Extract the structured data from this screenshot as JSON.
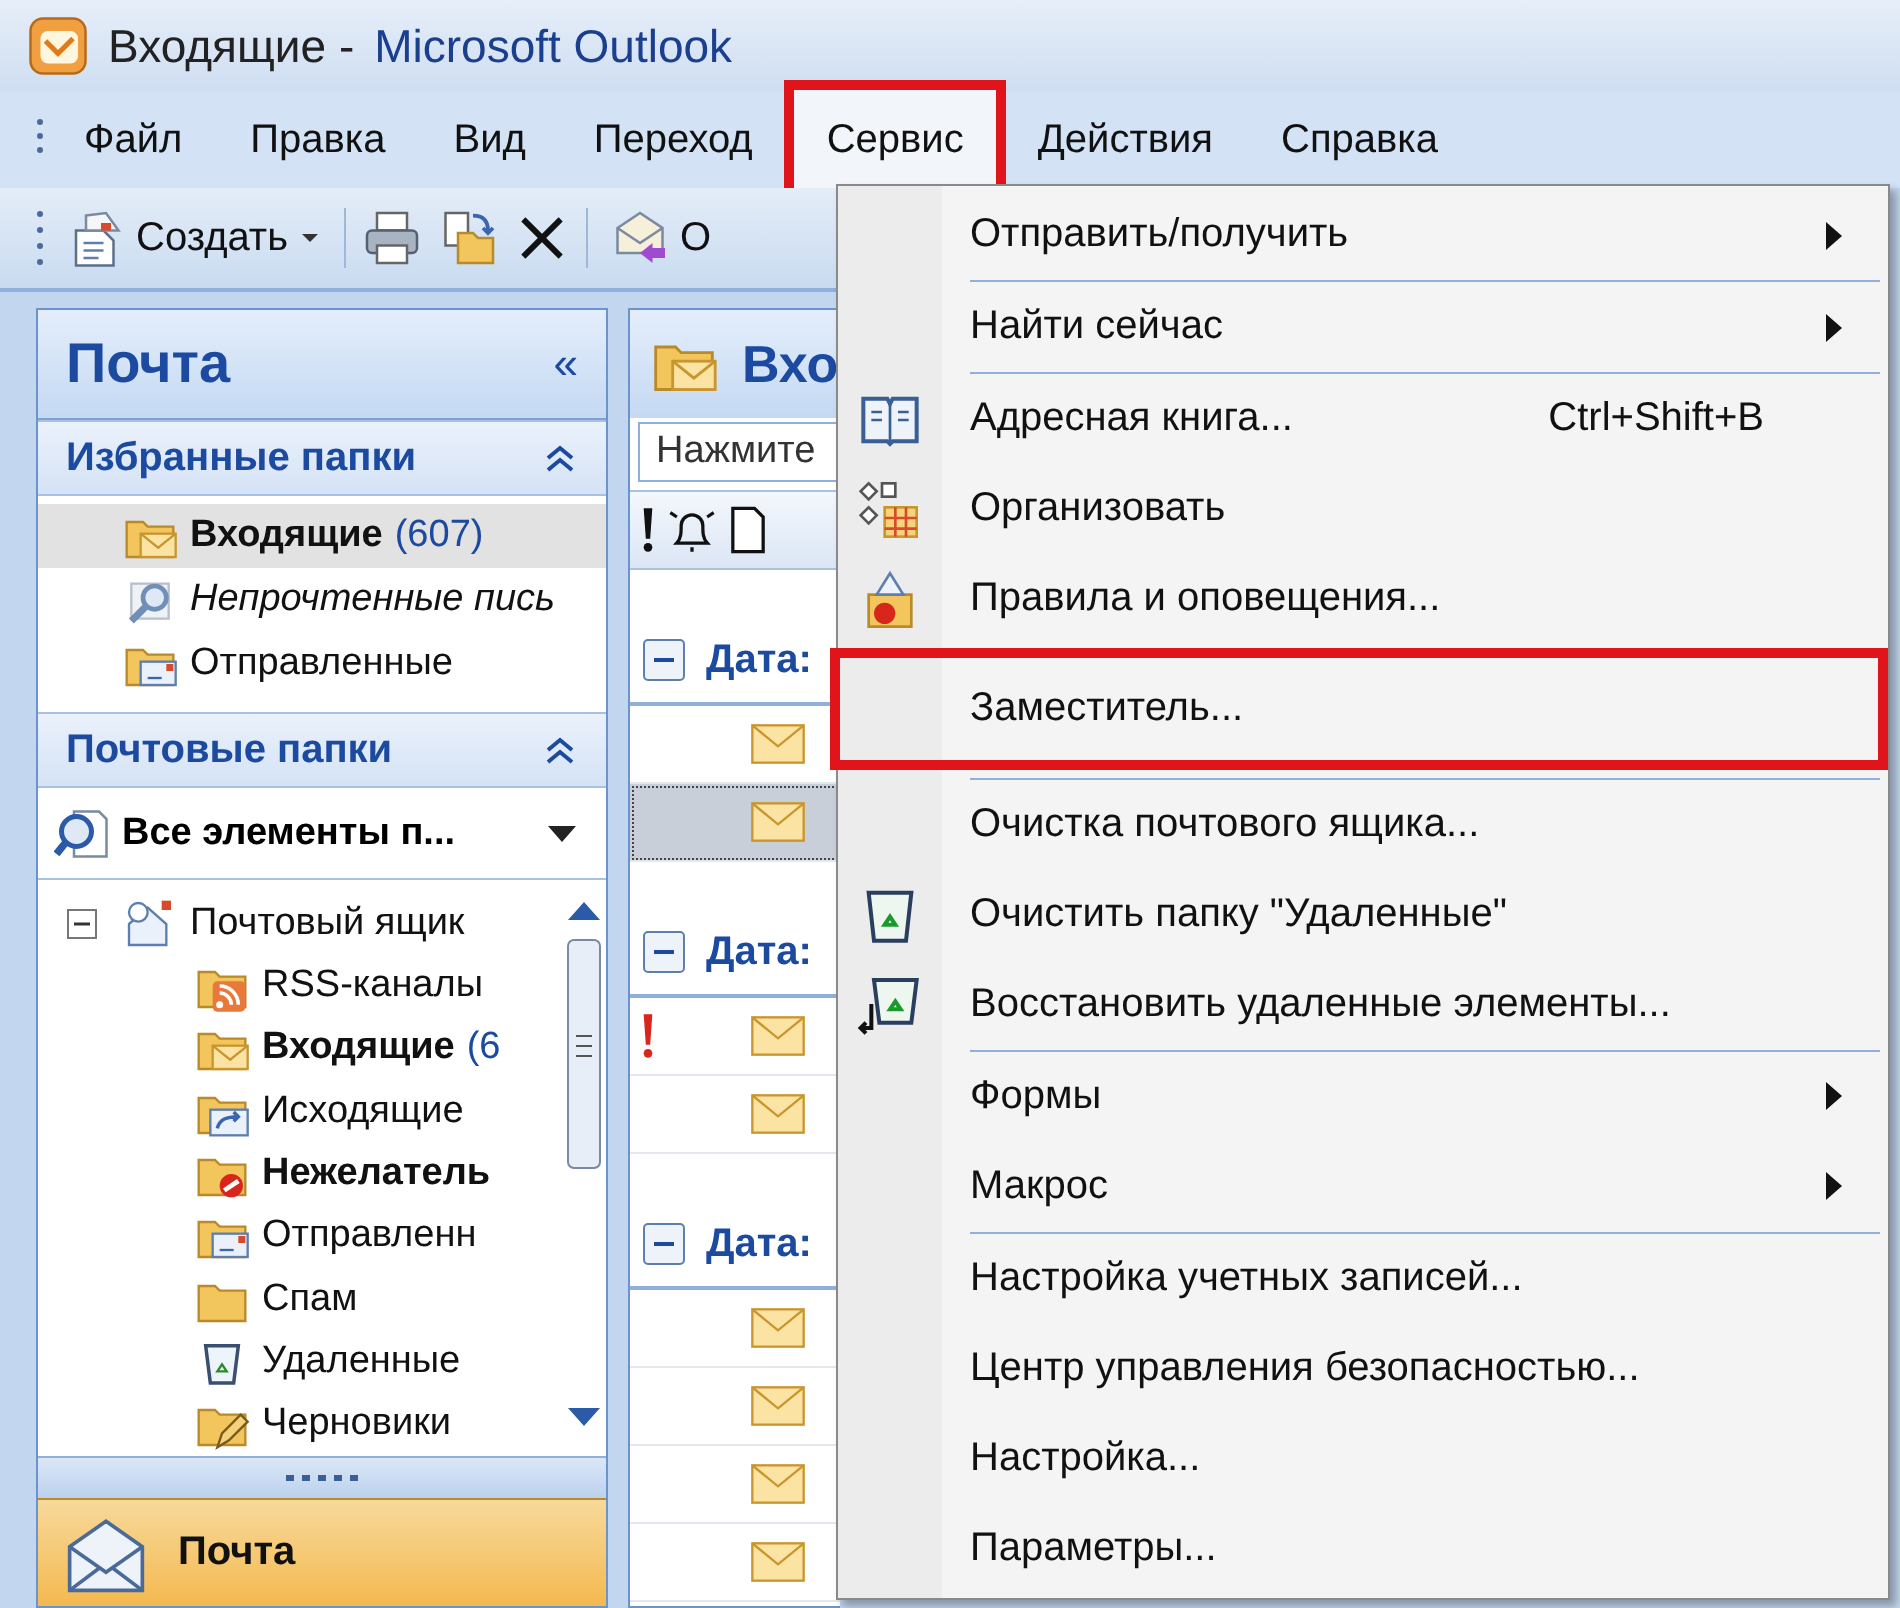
{
  "window": {
    "title_folder": "Входящие -",
    "title_app": "Microsoft Outlook"
  },
  "menu_bar": [
    {
      "label": "Файл",
      "open": false,
      "highlighted": false
    },
    {
      "label": "Правка",
      "open": false,
      "highlighted": false
    },
    {
      "label": "Вид",
      "open": false,
      "highlighted": false
    },
    {
      "label": "Переход",
      "open": false,
      "highlighted": false
    },
    {
      "label": "Сервис",
      "open": true,
      "highlighted": true
    },
    {
      "label": "Действия",
      "open": false,
      "highlighted": false
    },
    {
      "label": "Справка",
      "open": false,
      "highlighted": false
    }
  ],
  "toolbar": {
    "new_label": "Создать",
    "reply_label": "О"
  },
  "navigation": {
    "title": "Почта",
    "collapse": "«",
    "favorites": {
      "title": "Избранные папки",
      "expanded": true,
      "items": [
        {
          "kind": "inbox",
          "label": "Входящие",
          "count": "(607)",
          "unread": true,
          "selected": true
        },
        {
          "kind": "search",
          "label": "Непрочтенные пись",
          "unread": false,
          "selected": false
        },
        {
          "kind": "sent",
          "label": "Отправленные",
          "unread": false,
          "selected": false
        }
      ]
    },
    "mail_folders": {
      "title": "Почтовые папки",
      "expanded": true,
      "view": "Все элементы п...",
      "tree": [
        {
          "kind": "mailbox",
          "label": "Почтовый ящик",
          "unread": false,
          "selected": false,
          "expanded": true,
          "children": [
            {
              "kind": "rss",
              "label": "RSS-каналы",
              "unread": false,
              "selected": false
            },
            {
              "kind": "inbox",
              "label": "Входящие",
              "count": "(6",
              "unread": true,
              "selected": false
            },
            {
              "kind": "outbox",
              "label": "Исходящие",
              "unread": false,
              "selected": false
            },
            {
              "kind": "junk",
              "label": "Нежелатель",
              "unread": true,
              "selected": false
            },
            {
              "kind": "sent",
              "label": "Отправленн",
              "unread": false,
              "selected": false
            },
            {
              "kind": "folder",
              "label": "Спам",
              "unread": false,
              "selected": false
            },
            {
              "kind": "deleted",
              "label": "Удаленные",
              "unread": false,
              "selected": false
            },
            {
              "kind": "drafts",
              "label": "Черновики",
              "unread": false,
              "selected": false
            }
          ]
        }
      ]
    },
    "buttons": [
      {
        "label": "Почта",
        "selected": true
      }
    ]
  },
  "message_list": {
    "title": "Вхо",
    "filter_placeholder": "Нажмите",
    "groups": [
      {
        "label": "Дата:",
        "expanded": true,
        "messages": [
          {
            "important": false,
            "selected": false
          },
          {
            "important": false,
            "selected": true
          }
        ]
      },
      {
        "label": "Дата:",
        "expanded": true,
        "messages": [
          {
            "important": true,
            "selected": false
          },
          {
            "important": false,
            "selected": false
          }
        ]
      },
      {
        "label": "Дата:",
        "expanded": true,
        "messages": [
          {
            "important": false,
            "selected": false
          },
          {
            "important": false,
            "selected": false
          },
          {
            "important": false,
            "selected": false
          },
          {
            "important": false,
            "selected": false
          }
        ]
      }
    ]
  },
  "dropdown_menu": {
    "groups": [
      [
        {
          "label": "Отправить/получить",
          "submenu": true,
          "highlighted": false
        }
      ],
      [
        {
          "label": "Найти сейчас",
          "submenu": true,
          "highlighted": false
        }
      ],
      [
        {
          "label": "Адресная книга...",
          "shortcut": "Ctrl+Shift+B",
          "submenu": false,
          "highlighted": false
        },
        {
          "label": "Организовать",
          "submenu": false,
          "highlighted": false
        },
        {
          "label": "Правила и оповещения...",
          "submenu": false,
          "highlighted": false
        },
        {
          "label": "Заместитель...",
          "submenu": false,
          "highlighted": true
        }
      ],
      [
        {
          "label": "Очистка почтового ящика...",
          "submenu": false,
          "highlighted": false
        },
        {
          "label": "Очистить папку \"Удаленные\"",
          "submenu": false,
          "highlighted": false
        },
        {
          "label": "Восстановить удаленные элементы...",
          "submenu": false,
          "highlighted": false
        }
      ],
      [
        {
          "label": "Формы",
          "submenu": true,
          "highlighted": false
        },
        {
          "label": "Макрос",
          "submenu": true,
          "highlighted": false
        }
      ],
      [
        {
          "label": "Настройка учетных записей...",
          "submenu": false,
          "highlighted": false
        },
        {
          "label": "Центр управления безопасностью...",
          "submenu": false,
          "highlighted": false
        },
        {
          "label": "Настройка...",
          "submenu": false,
          "highlighted": false
        },
        {
          "label": "Параметры...",
          "submenu": false,
          "highlighted": false
        }
      ]
    ]
  }
}
